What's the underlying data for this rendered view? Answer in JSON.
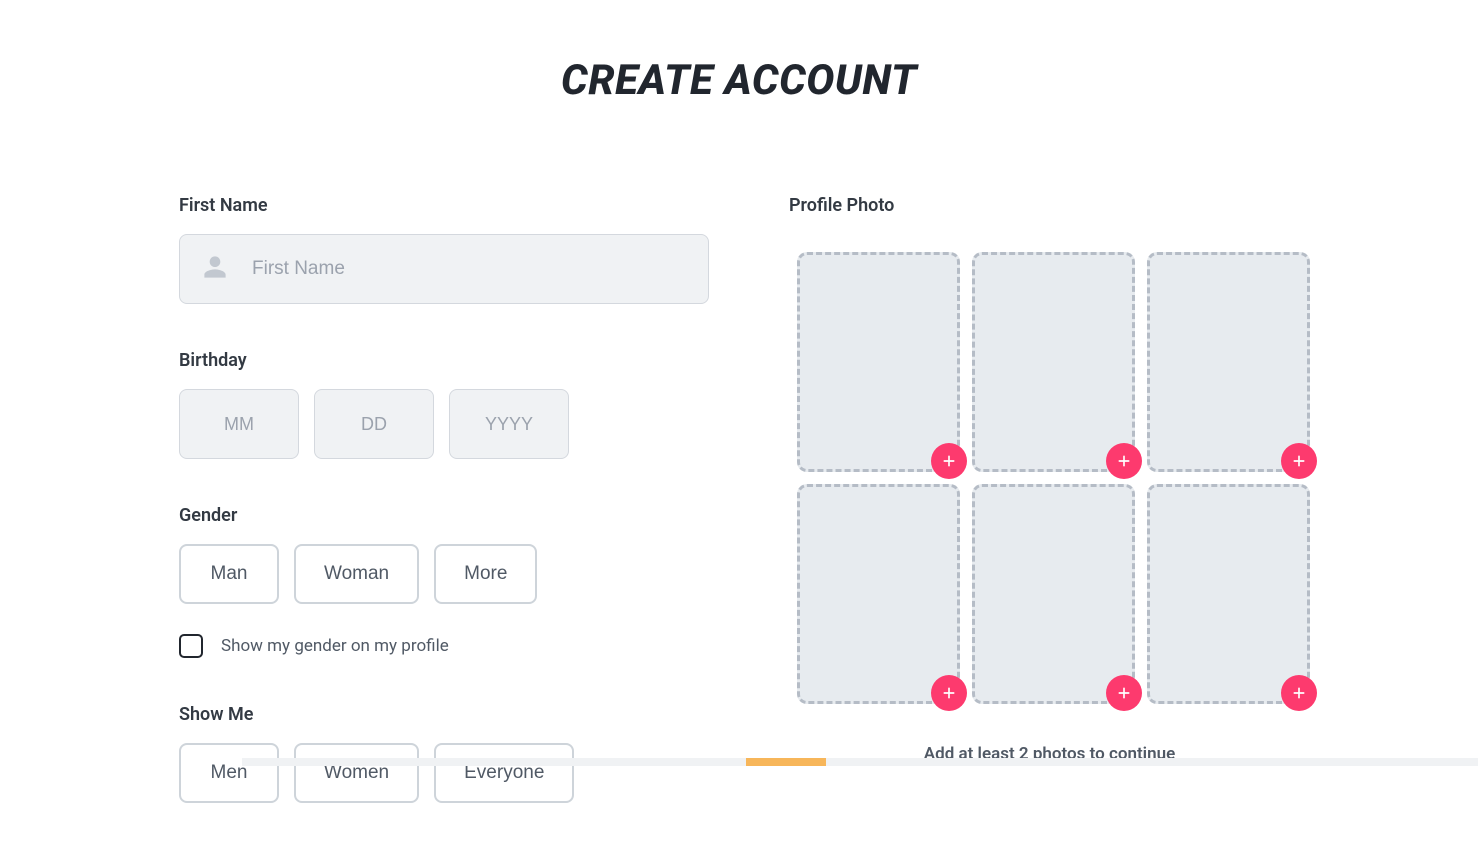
{
  "page": {
    "title": "CREATE ACCOUNT"
  },
  "form": {
    "first_name": {
      "label": "First Name",
      "placeholder": "First Name",
      "value": ""
    },
    "birthday": {
      "label": "Birthday",
      "mm": {
        "placeholder": "MM",
        "value": ""
      },
      "dd": {
        "placeholder": "DD",
        "value": ""
      },
      "yyyy": {
        "placeholder": "YYYY",
        "value": ""
      }
    },
    "gender": {
      "label": "Gender",
      "options": {
        "man": "Man",
        "woman": "Woman",
        "more": "More"
      },
      "show_label": "Show my gender on my profile"
    },
    "show_me": {
      "label": "Show Me",
      "options": {
        "men": "Men",
        "women": "Women",
        "everyone": "Everyone"
      }
    }
  },
  "photos": {
    "label": "Profile Photo",
    "hint": "Add at least 2 photos to continue",
    "slot_count": 6
  },
  "colors": {
    "accent": "#fd3a6e"
  }
}
